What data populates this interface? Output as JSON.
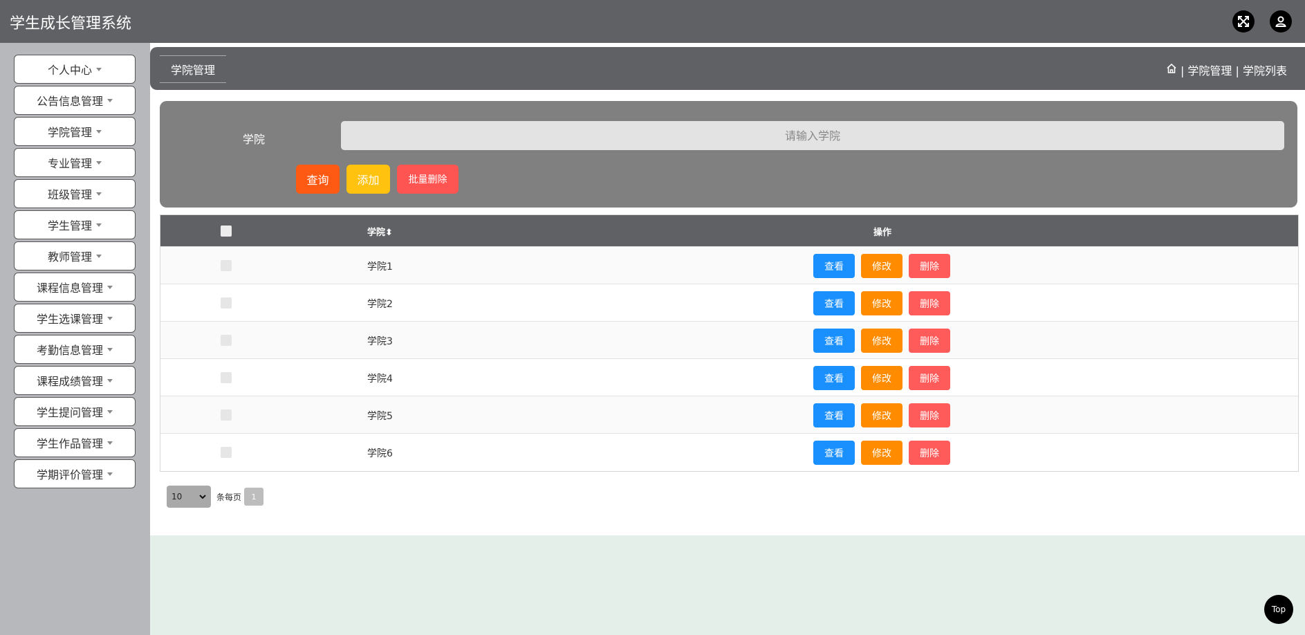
{
  "app": {
    "title": "学生成长管理系统"
  },
  "header": {
    "fullscreen_icon": "expand-arrows-icon",
    "user_icon": "user-icon"
  },
  "sidebar": {
    "items": [
      {
        "label": "个人中心"
      },
      {
        "label": "公告信息管理"
      },
      {
        "label": "学院管理"
      },
      {
        "label": "专业管理"
      },
      {
        "label": "班级管理"
      },
      {
        "label": "学生管理"
      },
      {
        "label": "教师管理"
      },
      {
        "label": "课程信息管理"
      },
      {
        "label": "学生选课管理"
      },
      {
        "label": "考勤信息管理"
      },
      {
        "label": "课程成绩管理"
      },
      {
        "label": "学生提问管理"
      },
      {
        "label": "学生作品管理"
      },
      {
        "label": "学期评价管理"
      }
    ]
  },
  "breadcrumb": {
    "active_tab": "学院管理",
    "home_icon": "home-icon",
    "path": "| 学院管理 | 学院列表"
  },
  "search": {
    "label": "学院",
    "placeholder": "请输入学院",
    "query_label": "查询",
    "add_label": "添加",
    "batch_delete_label": "批量删除"
  },
  "table": {
    "header_name": "学院",
    "sort_icon": "⬍",
    "header_actions": "操作",
    "rows": [
      {
        "name": "学院1"
      },
      {
        "name": "学院2"
      },
      {
        "name": "学院3"
      },
      {
        "name": "学院4"
      },
      {
        "name": "学院5"
      },
      {
        "name": "学院6"
      }
    ],
    "view_label": "查看",
    "edit_label": "修改",
    "delete_label": "删除"
  },
  "pagination": {
    "page_size": "10",
    "per_page_label": "条每页",
    "current_page": "1"
  },
  "back_to_top": "Top",
  "colors": {
    "query": "#ff5a14",
    "add": "#ffc20e",
    "batch_delete": "#fe5553",
    "view": "#1a90ff",
    "edit": "#ff8c00",
    "delete": "#ff5b5b"
  }
}
